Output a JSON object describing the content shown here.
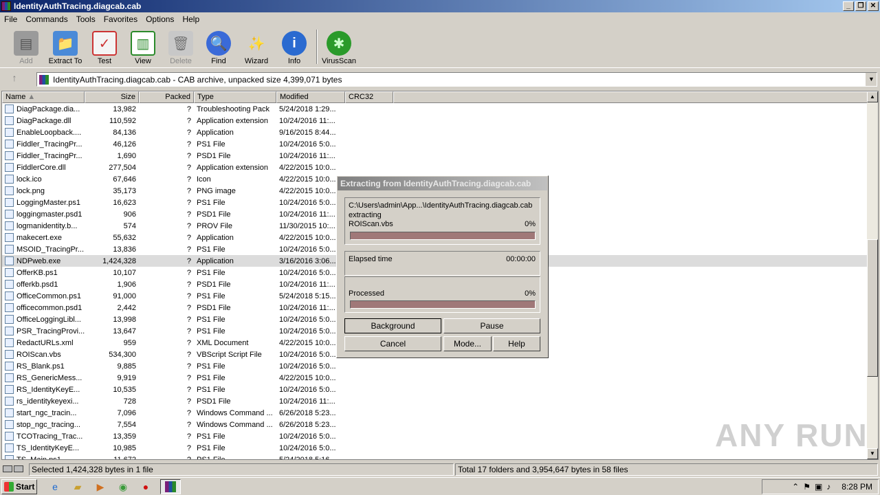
{
  "window": {
    "title": "IdentityAuthTracing.diagcab.cab"
  },
  "menu": [
    "File",
    "Commands",
    "Tools",
    "Favorites",
    "Options",
    "Help"
  ],
  "toolbar": {
    "add": "Add",
    "extract": "Extract To",
    "test": "Test",
    "view": "View",
    "delete": "Delete",
    "find": "Find",
    "wizard": "Wizard",
    "info": "Info",
    "virusscan": "VirusScan"
  },
  "address": {
    "text": "IdentityAuthTracing.diagcab.cab - CAB archive, unpacked size 4,399,071 bytes"
  },
  "columns": {
    "name": "Name",
    "size": "Size",
    "packed": "Packed",
    "type": "Type",
    "modified": "Modified",
    "crc": "CRC32"
  },
  "files": [
    {
      "name": "DiagPackage.dia...",
      "size": "13,982",
      "packed": "?",
      "type": "Troubleshooting Pack",
      "modified": "5/24/2018 1:29..."
    },
    {
      "name": "DiagPackage.dll",
      "size": "110,592",
      "packed": "?",
      "type": "Application extension",
      "modified": "10/24/2016 11:..."
    },
    {
      "name": "EnableLoopback....",
      "size": "84,136",
      "packed": "?",
      "type": "Application",
      "modified": "9/16/2015 8:44..."
    },
    {
      "name": "Fiddler_TracingPr...",
      "size": "46,126",
      "packed": "?",
      "type": "PS1 File",
      "modified": "10/24/2016 5:0..."
    },
    {
      "name": "Fiddler_TracingPr...",
      "size": "1,690",
      "packed": "?",
      "type": "PSD1 File",
      "modified": "10/24/2016 11:..."
    },
    {
      "name": "FiddlerCore.dll",
      "size": "277,504",
      "packed": "?",
      "type": "Application extension",
      "modified": "4/22/2015 10:0..."
    },
    {
      "name": "lock.ico",
      "size": "67,646",
      "packed": "?",
      "type": "Icon",
      "modified": "4/22/2015 10:0..."
    },
    {
      "name": "lock.png",
      "size": "35,173",
      "packed": "?",
      "type": "PNG image",
      "modified": "4/22/2015 10:0..."
    },
    {
      "name": "LoggingMaster.ps1",
      "size": "16,623",
      "packed": "?",
      "type": "PS1 File",
      "modified": "10/24/2016 5:0..."
    },
    {
      "name": "loggingmaster.psd1",
      "size": "906",
      "packed": "?",
      "type": "PSD1 File",
      "modified": "10/24/2016 11:..."
    },
    {
      "name": "logmanidentity.b...",
      "size": "574",
      "packed": "?",
      "type": "PROV File",
      "modified": "11/30/2015 10:..."
    },
    {
      "name": "makecert.exe",
      "size": "55,632",
      "packed": "?",
      "type": "Application",
      "modified": "4/22/2015 10:0..."
    },
    {
      "name": "MSOID_TracingPr...",
      "size": "13,836",
      "packed": "?",
      "type": "PS1 File",
      "modified": "10/24/2016 5:0..."
    },
    {
      "name": "NDPweb.exe",
      "size": "1,424,328",
      "packed": "?",
      "type": "Application",
      "modified": "3/16/2016 3:06..."
    },
    {
      "name": "OfferKB.ps1",
      "size": "10,107",
      "packed": "?",
      "type": "PS1 File",
      "modified": "10/24/2016 5:0..."
    },
    {
      "name": "offerkb.psd1",
      "size": "1,906",
      "packed": "?",
      "type": "PSD1 File",
      "modified": "10/24/2016 11:..."
    },
    {
      "name": "OfficeCommon.ps1",
      "size": "91,000",
      "packed": "?",
      "type": "PS1 File",
      "modified": "5/24/2018 5:15..."
    },
    {
      "name": "officecommon.psd1",
      "size": "2,442",
      "packed": "?",
      "type": "PSD1 File",
      "modified": "10/24/2016 11:..."
    },
    {
      "name": "OfficeLoggingLibl...",
      "size": "13,998",
      "packed": "?",
      "type": "PS1 File",
      "modified": "10/24/2016 5:0..."
    },
    {
      "name": "PSR_TracingProvi...",
      "size": "13,647",
      "packed": "?",
      "type": "PS1 File",
      "modified": "10/24/2016 5:0..."
    },
    {
      "name": "RedactURLs.xml",
      "size": "959",
      "packed": "?",
      "type": "XML Document",
      "modified": "4/22/2015 10:0..."
    },
    {
      "name": "ROIScan.vbs",
      "size": "534,300",
      "packed": "?",
      "type": "VBScript Script File",
      "modified": "10/24/2016 5:0..."
    },
    {
      "name": "RS_Blank.ps1",
      "size": "9,885",
      "packed": "?",
      "type": "PS1 File",
      "modified": "10/24/2016 5:0..."
    },
    {
      "name": "RS_GenericMess...",
      "size": "9,919",
      "packed": "?",
      "type": "PS1 File",
      "modified": "4/22/2015 10:0..."
    },
    {
      "name": "RS_IdentityKeyE...",
      "size": "10,535",
      "packed": "?",
      "type": "PS1 File",
      "modified": "10/24/2016 5:0..."
    },
    {
      "name": "rs_identitykeyexi...",
      "size": "728",
      "packed": "?",
      "type": "PSD1 File",
      "modified": "10/24/2016 11:..."
    },
    {
      "name": "start_ngc_tracin...",
      "size": "7,096",
      "packed": "?",
      "type": "Windows Command ...",
      "modified": "6/26/2018 5:23..."
    },
    {
      "name": "stop_ngc_tracing...",
      "size": "7,554",
      "packed": "?",
      "type": "Windows Command ...",
      "modified": "6/26/2018 5:23..."
    },
    {
      "name": "TCOTracing_Trac...",
      "size": "13,359",
      "packed": "?",
      "type": "PS1 File",
      "modified": "10/24/2016 5:0..."
    },
    {
      "name": "TS_IdentityKeyE...",
      "size": "10,985",
      "packed": "?",
      "type": "PS1 File",
      "modified": "10/24/2016 5:0..."
    },
    {
      "name": "TS_Main.ps1",
      "size": "11,672",
      "packed": "?",
      "type": "PS1 File",
      "modified": "5/24/2018 5:16..."
    }
  ],
  "status": {
    "left": "Selected 1,424,328 bytes in 1 file",
    "right": "Total 17 folders and 3,954,647 bytes in 58 files"
  },
  "dialog": {
    "title": "Extracting from IdentityAuthTracing.diagcab.cab",
    "path": "C:\\Users\\admin\\App...\\IdentityAuthTracing.diagcab.cab",
    "action": "extracting",
    "file": "ROIScan.vbs",
    "file_pct": "0%",
    "elapsed_label": "Elapsed time",
    "elapsed_value": "00:00:00",
    "processed_label": "Processed",
    "processed_pct": "0%",
    "buttons": {
      "background": "Background",
      "pause": "Pause",
      "cancel": "Cancel",
      "mode": "Mode...",
      "help": "Help"
    }
  },
  "taskbar": {
    "start": "Start",
    "clock": "8:28 PM"
  },
  "watermark": "ANY RUN"
}
